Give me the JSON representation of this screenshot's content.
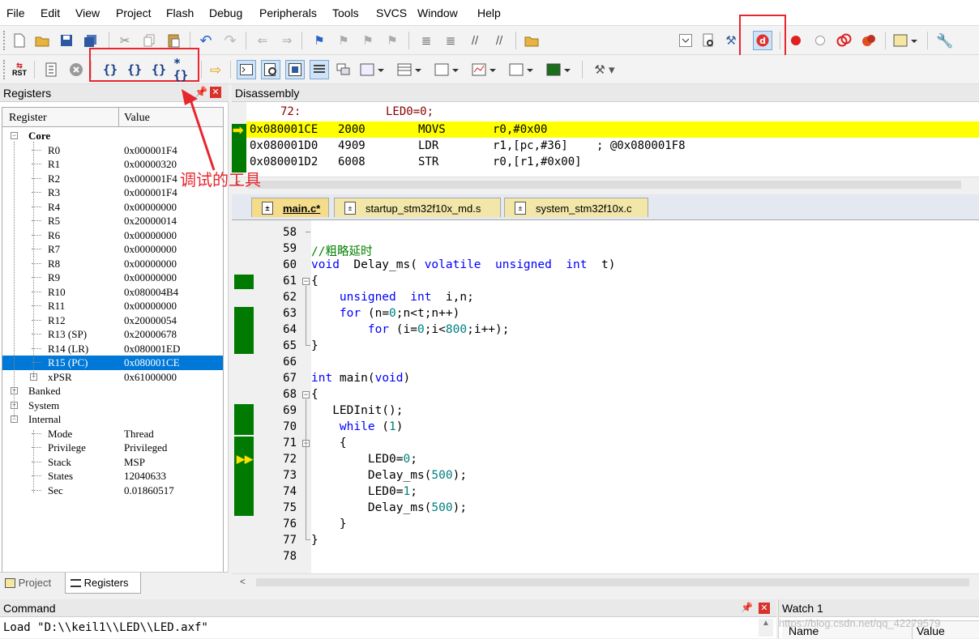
{
  "menu": [
    "File",
    "Edit",
    "View",
    "Project",
    "Flash",
    "Debug",
    "Peripherals",
    "Tools",
    "SVCS",
    "Window",
    "Help"
  ],
  "annotation": {
    "label": "调试的工具"
  },
  "registers": {
    "title": "Registers",
    "col_register": "Register",
    "col_value": "Value",
    "core_label": "Core",
    "core": [
      {
        "name": "R0",
        "value": "0x000001F4"
      },
      {
        "name": "R1",
        "value": "0x00000320"
      },
      {
        "name": "R2",
        "value": "0x000001F4"
      },
      {
        "name": "R3",
        "value": "0x000001F4"
      },
      {
        "name": "R4",
        "value": "0x00000000"
      },
      {
        "name": "R5",
        "value": "0x20000014"
      },
      {
        "name": "R6",
        "value": "0x00000000"
      },
      {
        "name": "R7",
        "value": "0x00000000"
      },
      {
        "name": "R8",
        "value": "0x00000000"
      },
      {
        "name": "R9",
        "value": "0x00000000"
      },
      {
        "name": "R10",
        "value": "0x080004B4"
      },
      {
        "name": "R11",
        "value": "0x00000000"
      },
      {
        "name": "R12",
        "value": "0x20000054"
      },
      {
        "name": "R13 (SP)",
        "value": "0x20000678"
      },
      {
        "name": "R14 (LR)",
        "value": "0x080001ED"
      },
      {
        "name": "R15 (PC)",
        "value": "0x080001CE"
      },
      {
        "name": "xPSR",
        "value": "0x61000000"
      }
    ],
    "groups": [
      "Banked",
      "System",
      "Internal"
    ],
    "internal": [
      {
        "name": "Mode",
        "value": "Thread"
      },
      {
        "name": "Privilege",
        "value": "Privileged"
      },
      {
        "name": "Stack",
        "value": "MSP"
      },
      {
        "name": "States",
        "value": "12040633"
      },
      {
        "name": "Sec",
        "value": "0.01860517"
      }
    ],
    "bottom_tabs": [
      "Project",
      "Registers"
    ]
  },
  "disassembly": {
    "title": "Disassembly",
    "source_line": {
      "num": "72:",
      "code": "LED0=0;"
    },
    "lines": [
      {
        "addr": "0x080001CE",
        "op": "2000",
        "mn": "MOVS",
        "args": "r0,#0x00",
        "comment": ""
      },
      {
        "addr": "0x080001D0",
        "op": "4909",
        "mn": "LDR",
        "args": "r1,[pc,#36]",
        "comment": "; @0x080001F8"
      },
      {
        "addr": "0x080001D2",
        "op": "6008",
        "mn": "STR",
        "args": "r0,[r1,#0x00]",
        "comment": ""
      }
    ]
  },
  "editor": {
    "tabs": [
      "main.c*",
      "startup_stm32f10x_md.s",
      "system_stm32f10x.c"
    ],
    "line_numbers": [
      "58",
      "59",
      "60",
      "61",
      "62",
      "63",
      "64",
      "65",
      "66",
      "67",
      "68",
      "69",
      "70",
      "71",
      "72",
      "73",
      "74",
      "75",
      "76",
      "77",
      "78"
    ]
  },
  "command": {
    "title": "Command",
    "text": "Load \"D:\\\\keil1\\\\LED\\\\LED.axf\""
  },
  "watch": {
    "title": "Watch 1",
    "col_name": "Name",
    "col_value": "Value",
    "watermark": "https://blog.csdn.net/qq_42279579"
  },
  "colors": {
    "highlight": "#ffff00",
    "selection": "#0078d7",
    "breakpoint_bar": "#007a00",
    "annotation": "#e8262d"
  }
}
